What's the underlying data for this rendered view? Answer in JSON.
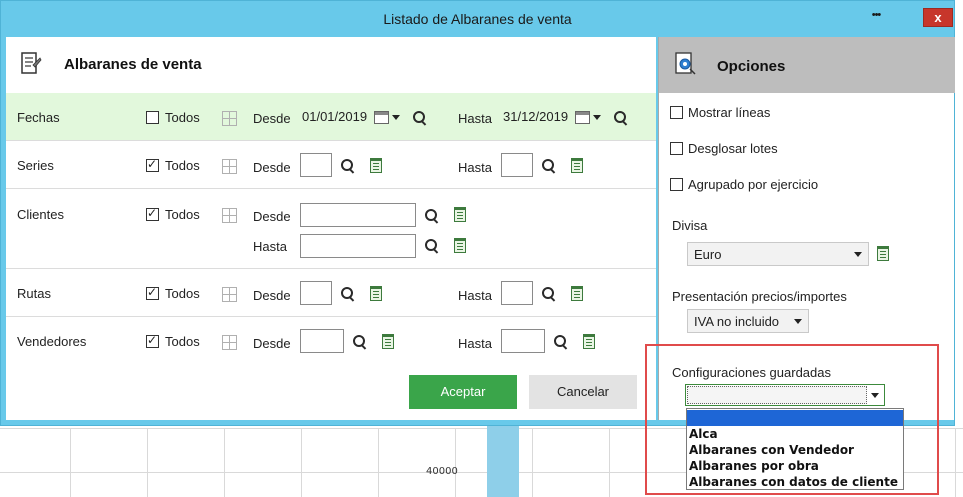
{
  "window": {
    "title": "Listado de Albaranes de venta",
    "ellipsis": "•••",
    "close": "x"
  },
  "left": {
    "title": "Albaranes de venta",
    "rows": {
      "fechas": {
        "label": "Fechas",
        "todos": "Todos",
        "todos_checked": false,
        "desde": "Desde",
        "desde_value": "01/01/2019",
        "hasta": "Hasta",
        "hasta_value": "31/12/2019"
      },
      "series": {
        "label": "Series",
        "todos": "Todos",
        "todos_checked": true,
        "desde": "Desde",
        "hasta": "Hasta"
      },
      "clientes": {
        "label": "Clientes",
        "todos": "Todos",
        "todos_checked": true,
        "desde": "Desde",
        "hasta": "Hasta"
      },
      "rutas": {
        "label": "Rutas",
        "todos": "Todos",
        "todos_checked": true,
        "desde": "Desde",
        "hasta": "Hasta"
      },
      "vendedores": {
        "label": "Vendedores",
        "todos": "Todos",
        "todos_checked": true,
        "desde": "Desde",
        "hasta": "Hasta"
      }
    },
    "accept": "Aceptar",
    "cancel": "Cancelar"
  },
  "right": {
    "title": "Opciones",
    "mostrar_lineas": "Mostrar líneas",
    "desglosar_lotes": "Desglosar lotes",
    "agrupado": "Agrupado por ejercicio",
    "divisa_label": "Divisa",
    "divisa_value": "Euro",
    "presentacion_label": "Presentación precios/importes",
    "presentacion_value": "IVA no incluido",
    "config_label": "Configuraciones guardadas",
    "config_value": "",
    "config_options": [
      "",
      "Alca",
      "Albaranes con Vendedor",
      "Albaranes por obra",
      "Albaranes con datos de cliente"
    ]
  },
  "background": {
    "tick_label": "40000"
  },
  "colors": {
    "titlebar": "#68c9ea",
    "accept": "#3aa54a",
    "highlight_row": "#e2f8dc",
    "close": "#c7362b",
    "dropdown_selected": "#1e66d6",
    "annotation_box": "#e04b4b"
  }
}
